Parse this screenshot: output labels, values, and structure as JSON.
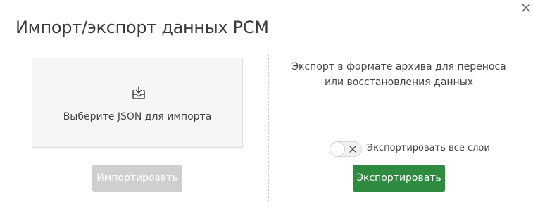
{
  "dialog": {
    "title": "Импорт/экспорт данных PCM",
    "close_icon": "close-icon"
  },
  "import": {
    "dropzone_label": "Выберите JSON для импорта",
    "dropzone_icon": "upload-tray-icon",
    "button_label": "Импортировать",
    "button_enabled": false
  },
  "export": {
    "description": "Экспорт в формате архива для переноса или восстановления данных",
    "toggle_label": "Экспортировать все слои",
    "toggle_on": false,
    "button_label": "Экспортировать"
  },
  "colors": {
    "export_button": "#2d8a3e",
    "import_button_disabled": "#cfcfcf",
    "dropzone_bg": "#f6f6f6"
  }
}
